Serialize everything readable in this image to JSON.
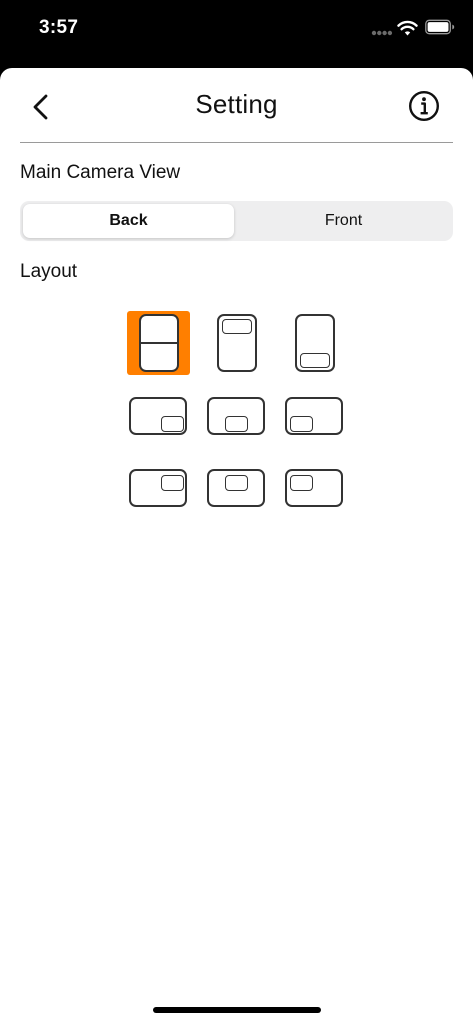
{
  "status_bar": {
    "time": "3:57",
    "icons": [
      "signal-dots-icon",
      "wifi-icon",
      "battery-icon"
    ]
  },
  "nav": {
    "title": "Setting",
    "back_icon": "chevron-left-icon",
    "info_icon": "info-circle-icon"
  },
  "main_camera": {
    "label": "Main Camera View",
    "options": [
      "Back",
      "Front"
    ],
    "selected": "Back"
  },
  "layout": {
    "label": "Layout",
    "selected_index": 0,
    "options": [
      {
        "orientation": "portrait",
        "style": "split-horizontal"
      },
      {
        "orientation": "portrait",
        "style": "pip-top"
      },
      {
        "orientation": "portrait",
        "style": "pip-bottom"
      },
      {
        "orientation": "landscape",
        "style": "pip-bottom-right"
      },
      {
        "orientation": "landscape",
        "style": "pip-bottom-center"
      },
      {
        "orientation": "landscape",
        "style": "pip-bottom-left"
      },
      {
        "orientation": "landscape",
        "style": "pip-top-right"
      },
      {
        "orientation": "landscape",
        "style": "pip-top-center"
      },
      {
        "orientation": "landscape",
        "style": "pip-top-left"
      }
    ]
  },
  "colors": {
    "accent": "#ff7f00",
    "stroke": "#333333",
    "segment_bg": "#eeeeef"
  }
}
